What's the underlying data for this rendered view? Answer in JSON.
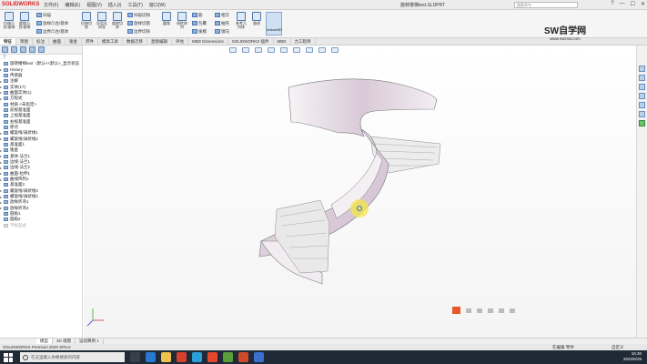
{
  "app": {
    "logo": "SOLIDWORKS",
    "menu": [
      "文件(F)",
      "编辑(E)",
      "视图(V)",
      "插入(I)",
      "工具(T)",
      "窗口(W)"
    ],
    "doc_title": "旋转楼梯test.SLDPRT",
    "search_placeholder": "搜索命令",
    "window_controls": [
      "?",
      "—",
      "☐",
      "✕"
    ]
  },
  "ribbon": {
    "big_buttons": [
      {
        "label": "拉伸凸台/基体",
        "icon": "extrude-boss-icon"
      },
      {
        "label": "旋转凸台/基体",
        "icon": "revolve-boss-icon"
      },
      {
        "label": "拉伸切除",
        "icon": "extrude-cut-icon"
      },
      {
        "label": "异型孔向导",
        "icon": "hole-wizard-icon"
      },
      {
        "label": "旋转切除",
        "icon": "revolve-cut-icon"
      },
      {
        "label": "圆角",
        "icon": "fillet-icon"
      },
      {
        "label": "线性阵列",
        "icon": "linear-pattern-icon"
      },
      {
        "label": "参考几何体",
        "icon": "reference-geometry-icon"
      },
      {
        "label": "曲线",
        "icon": "curves-icon"
      }
    ],
    "small_items": [
      "扫描",
      "放样凸台/基体",
      "边界凸台/基体",
      "扫描切除",
      "放样切割",
      "边界切除",
      "筋",
      "包覆",
      "拔模",
      "相交",
      "抽壳",
      "镜向"
    ],
    "instant3d_label": "Instant3D"
  },
  "watermark": {
    "title": "SW自学网",
    "url": "www.swzxw.com"
  },
  "tabs": [
    "特征",
    "草图",
    "标注",
    "曲面",
    "钣金",
    "焊件",
    "模具工具",
    "数据迁移",
    "直接编辑",
    "评估",
    "MBD Dimensions",
    "SOLIDWORKS 插件",
    "MBD",
    "力工程师"
  ],
  "tree": [
    {
      "label": "旋转楼梯test（默认<<默认>_显示状态",
      "exp": ""
    },
    {
      "label": "History",
      "exp": "▸"
    },
    {
      "label": "传感器",
      "exp": ""
    },
    {
      "label": "注解",
      "exp": "▸"
    },
    {
      "label": "实体(17)",
      "exp": "▸"
    },
    {
      "label": "曲面实体(1)",
      "exp": "▸"
    },
    {
      "label": "方程式",
      "exp": "▸"
    },
    {
      "label": "材质 <未指定>",
      "exp": ""
    },
    {
      "label": "前视基准面",
      "exp": ""
    },
    {
      "label": "上视基准面",
      "exp": ""
    },
    {
      "label": "右视基准面",
      "exp": ""
    },
    {
      "label": "原点",
      "exp": ""
    },
    {
      "label": "螺旋线/涡状线1",
      "exp": "▸"
    },
    {
      "label": "螺旋线/涡状线2",
      "exp": "▸"
    },
    {
      "label": "基准面1",
      "exp": ""
    },
    {
      "label": "钣金",
      "exp": "▸"
    },
    {
      "label": "基体-法兰1",
      "exp": "▸"
    },
    {
      "label": "边线-法兰1",
      "exp": "▸"
    },
    {
      "label": "边线-法兰2",
      "exp": "▸"
    },
    {
      "label": "曲面-拉伸1",
      "exp": "▸"
    },
    {
      "label": "曲线阵列1",
      "exp": "▸"
    },
    {
      "label": "基准面2",
      "exp": ""
    },
    {
      "label": "螺旋线/涡状线3",
      "exp": "▸"
    },
    {
      "label": "螺旋线/涡状线4",
      "exp": "▸"
    },
    {
      "label": "放样折弯1",
      "exp": "▸"
    },
    {
      "label": "放样折弯2",
      "exp": "▸"
    },
    {
      "label": "圆角1",
      "exp": ""
    },
    {
      "label": "圆角2",
      "exp": ""
    },
    {
      "label": "平板型式",
      "exp": "",
      "faded": true
    }
  ],
  "model_tabs": [
    "模型",
    "3D 视图",
    "运动算例 1"
  ],
  "status": {
    "left": "SOLIDWORKS Premium 2020 SP5.0",
    "edit": "在编辑 零件",
    "units": "自定义"
  },
  "taskbar": {
    "search_placeholder": "在这里输入你要搜索的内容",
    "time": "15:30",
    "date": "2022/6/25"
  }
}
